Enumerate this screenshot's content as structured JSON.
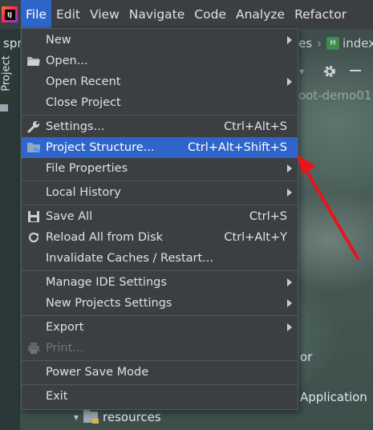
{
  "menubar": {
    "logo_text": "IJ",
    "items": [
      {
        "label": "File",
        "active": true
      },
      {
        "label": "Edit"
      },
      {
        "label": "View"
      },
      {
        "label": "Navigate"
      },
      {
        "label": "Code"
      },
      {
        "label": "Analyze"
      },
      {
        "label": "Refactor"
      }
    ]
  },
  "background": {
    "project_tab_label": "Project",
    "project_name_fragment": "spr",
    "breadcrumb_fragment": "es",
    "breadcrumb_file": "index",
    "module_fragment": "oot-demo01",
    "text_or": "or",
    "text_application": "Application",
    "tree_folder": "resources"
  },
  "file_menu": {
    "items": [
      {
        "label": "New",
        "icon": "",
        "shortcut": "",
        "submenu": true
      },
      {
        "label": "Open...",
        "icon": "folder-open-icon",
        "shortcut": "",
        "submenu": false
      },
      {
        "label": "Open Recent",
        "icon": "",
        "shortcut": "",
        "submenu": true
      },
      {
        "label": "Close Project",
        "icon": "",
        "shortcut": "",
        "submenu": false
      },
      {
        "label": "Settings...",
        "icon": "wrench-icon",
        "shortcut": "Ctrl+Alt+S",
        "submenu": false
      },
      {
        "label": "Project Structure...",
        "icon": "project-structure-icon",
        "shortcut": "Ctrl+Alt+Shift+S",
        "submenu": false,
        "selected": true
      },
      {
        "label": "File Properties",
        "icon": "",
        "shortcut": "",
        "submenu": true
      },
      {
        "label": "Local History",
        "icon": "",
        "shortcut": "",
        "submenu": true
      },
      {
        "label": "Save All",
        "icon": "save-icon",
        "shortcut": "Ctrl+S",
        "submenu": false
      },
      {
        "label": "Reload All from Disk",
        "icon": "reload-icon",
        "shortcut": "Ctrl+Alt+Y",
        "submenu": false
      },
      {
        "label": "Invalidate Caches / Restart...",
        "icon": "",
        "shortcut": "",
        "submenu": false
      },
      {
        "label": "Manage IDE Settings",
        "icon": "",
        "shortcut": "",
        "submenu": true
      },
      {
        "label": "New Projects Settings",
        "icon": "",
        "shortcut": "",
        "submenu": true
      },
      {
        "label": "Export",
        "icon": "",
        "shortcut": "",
        "submenu": true
      },
      {
        "label": "Print...",
        "icon": "print-icon",
        "shortcut": "",
        "submenu": false,
        "disabled": true
      },
      {
        "label": "Power Save Mode",
        "icon": "",
        "shortcut": "",
        "submenu": false
      },
      {
        "label": "Exit",
        "icon": "",
        "shortcut": "",
        "submenu": false
      }
    ]
  },
  "colors": {
    "menu_bg": "#3c3f41",
    "selection": "#2f65ca",
    "annotation_arrow": "#e8141b"
  }
}
